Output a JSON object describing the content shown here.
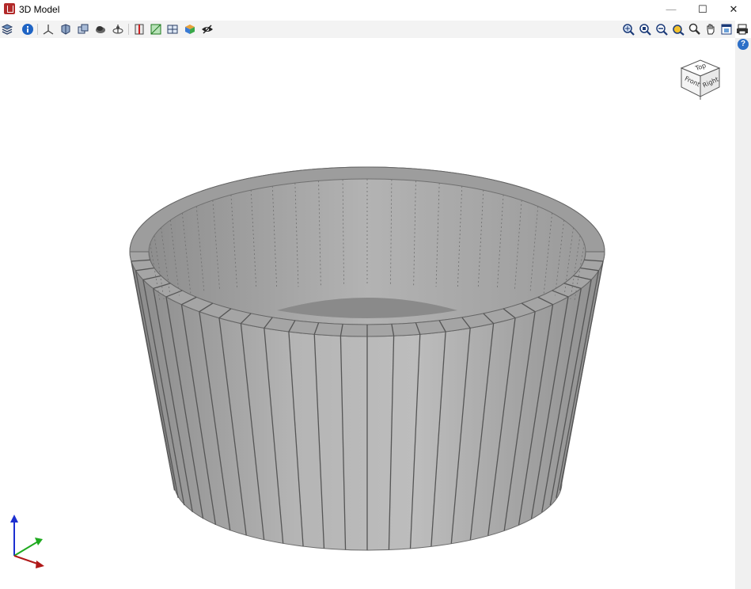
{
  "window": {
    "title": "3D Model",
    "minimize_glyph": "—",
    "maximize_glyph": "☐",
    "close_glyph": "✕"
  },
  "toolbar_left": [
    {
      "name": "layers-icon"
    },
    {
      "name": "info-icon"
    },
    {
      "name": "axes-icon"
    },
    {
      "name": "solid-view-icon"
    },
    {
      "name": "copy-view-icon"
    },
    {
      "name": "render-mode-icon"
    },
    {
      "name": "rotate-axis-icon"
    },
    {
      "name": "section-icon"
    },
    {
      "name": "green-plane-icon"
    },
    {
      "name": "grid-icon"
    },
    {
      "name": "color-cube-icon"
    },
    {
      "name": "visibility-eye-icon"
    }
  ],
  "toolbar_right": [
    {
      "name": "zoom-extents-icon"
    },
    {
      "name": "zoom-window-icon"
    },
    {
      "name": "zoom-in-out-icon"
    },
    {
      "name": "orbit-icon"
    },
    {
      "name": "zoom-icon"
    },
    {
      "name": "pan-hand-icon"
    },
    {
      "name": "viewport-icon"
    },
    {
      "name": "print-icon"
    }
  ],
  "help": {
    "glyph": "?"
  },
  "navcube": {
    "top": "Top",
    "front": "Front",
    "right": "Right"
  },
  "colors": {
    "model": "#a9a9a9",
    "model_dark": "#7a7a7a",
    "axis_x": "#b01818",
    "axis_y": "#1faa1f",
    "axis_z": "#1c2fd0"
  }
}
